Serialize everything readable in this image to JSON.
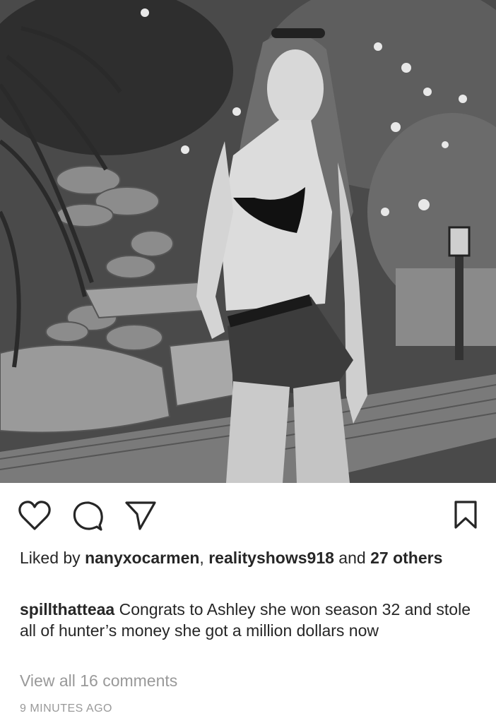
{
  "post": {
    "image_alt": "Black and white photo of a woman in a bikini top and shorts standing on a wooden deck by rocks and tropical plants",
    "likes": {
      "prefix": "Liked by ",
      "user1": "nanyxocarmen",
      "separator": ", ",
      "user2": "realityshows918",
      "and_text": " and ",
      "others_count": "27",
      "others_text": "others"
    },
    "caption": {
      "username": "spillthatteaa",
      "text": "Congrats to Ashley she won season 32 and stole all of hunter’s money she got a million dollars now"
    },
    "view_comments": "View all 16 comments",
    "timestamp": "9 MINUTES AGO"
  },
  "icons": {
    "like": "heart-icon",
    "comment": "comment-icon",
    "share": "paper-plane-icon",
    "save": "bookmark-icon"
  },
  "colors": {
    "text": "#262626",
    "muted": "#999999"
  }
}
